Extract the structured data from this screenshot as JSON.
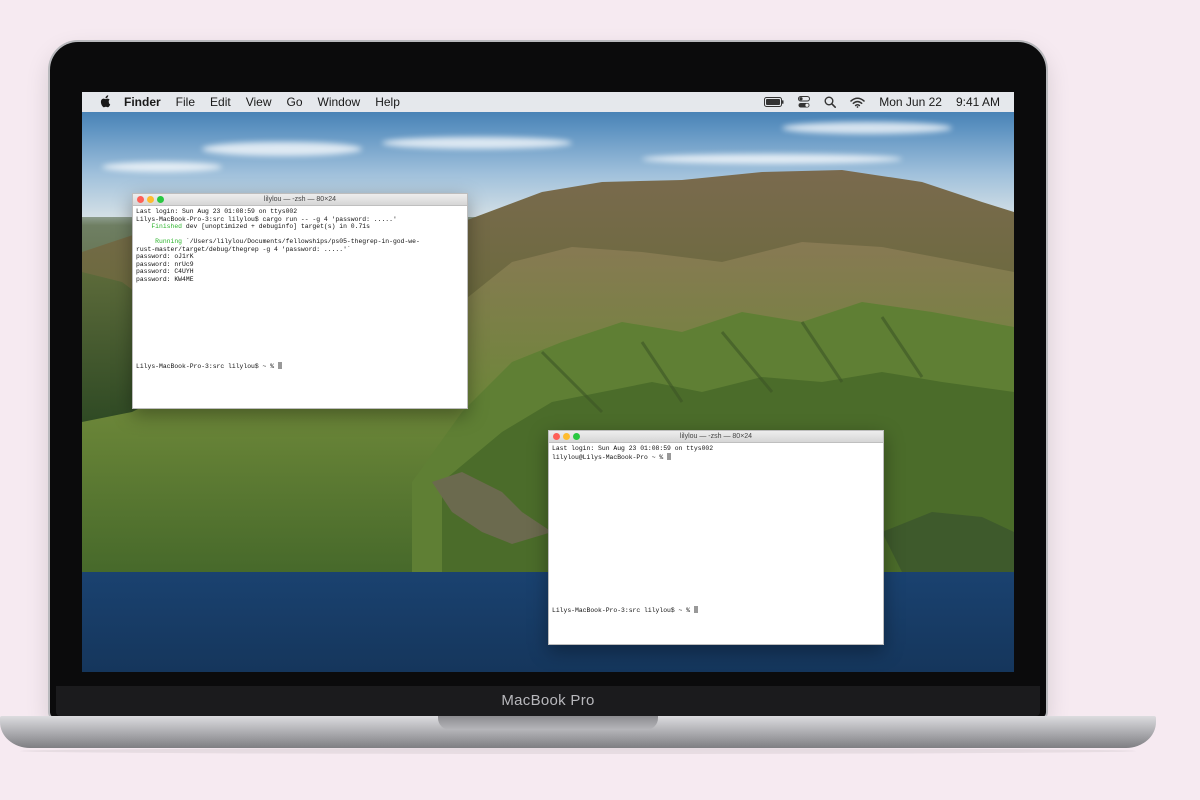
{
  "device_label": "MacBook Pro",
  "menubar": {
    "app_name": "Finder",
    "menus": [
      "File",
      "Edit",
      "View",
      "Go",
      "Window",
      "Help"
    ],
    "status_icons": [
      "battery-icon",
      "control-center-icon",
      "search-icon",
      "wifi-icon"
    ],
    "date": "Mon Jun 22",
    "time": "9:41 AM"
  },
  "terminal1": {
    "title": "lilylou — -zsh — 80×24",
    "lines": [
      {
        "text": "Last login: Sun Aug 23 01:08:59 on ttys002"
      },
      {
        "text": "Lilys-MacBook-Pro-3:src lilylou$ cargo run -- -g 4 'password: .....'"
      },
      {
        "green": "    Finished",
        "text": " dev [unoptimized + debuginfo] target(s) in 0.71s"
      },
      {
        "text": ""
      },
      {
        "green": "     Running",
        "text": " `/Users/lilylou/Documents/fellowships/ps05-thegrep-in-god-we-"
      },
      {
        "text": "rust-master/target/debug/thegrep -g 4 'password: .....'`"
      },
      {
        "text": "password: oJ1rK"
      },
      {
        "text": "password: nrUc9"
      },
      {
        "text": "password: C4UYH"
      },
      {
        "text": "password: KW4ME"
      }
    ],
    "prompt": "Lilys-MacBook-Pro-3:src lilylou$ ~ % "
  },
  "terminal2": {
    "title": "lilylou — -zsh — 80×24",
    "lines": [
      {
        "text": "Last login: Sun Aug 23 01:08:59 on ttys002"
      },
      {
        "text": "lilylou@Lilys-MacBook-Pro ~ % "
      }
    ],
    "prompt": "Lilys-MacBook-Pro-3:src lilylou$ ~ % "
  }
}
